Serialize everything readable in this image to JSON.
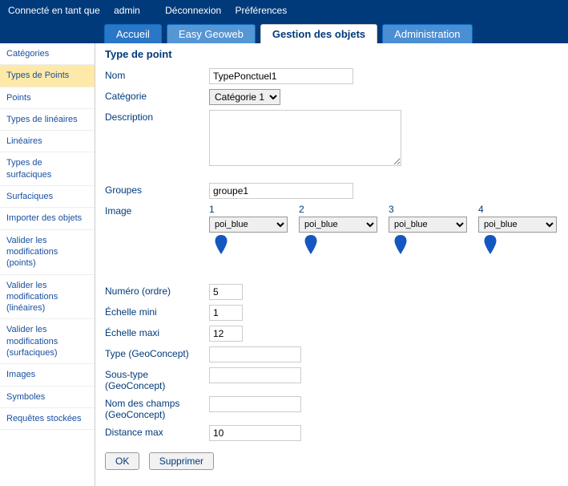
{
  "topbar": {
    "user_prefix": "Connecté en tant que ",
    "user": "admin",
    "logout": "Déconnexion",
    "prefs": "Préférences"
  },
  "tabs": {
    "home": "Accueil",
    "geoweb": "Easy Geoweb",
    "objects": "Gestion des objets",
    "admin": "Administration"
  },
  "sidebar": {
    "items": [
      "Catégories",
      "Types de Points",
      "Points",
      "Types de linéaires",
      "Linéaires",
      "Types de surfaciques",
      "Surfaciques",
      "Importer des objets",
      "Valider les modifications (points)",
      "Valider les modifications (linéaires)",
      "Valider les modifications (surfaciques)",
      "Images",
      "Symboles",
      "Requêtes stockées"
    ],
    "active_index": 1
  },
  "page": {
    "title": "Type de point"
  },
  "form": {
    "labels": {
      "nom": "Nom",
      "categorie": "Catégorie",
      "description": "Description",
      "groupes": "Groupes",
      "image": "Image",
      "numero": "Numéro (ordre)",
      "echelle_mini": "Échelle mini",
      "echelle_maxi": "Échelle maxi",
      "type_gc": "Type (GeoConcept)",
      "sous_type_gc": "Sous-type (GeoConcept)",
      "champs_gc": "Nom des champs (GeoConcept)",
      "distance_max": "Distance max"
    },
    "values": {
      "nom": "TypePonctuel1",
      "categorie": "Catégorie 1",
      "description": "",
      "groupes": "groupe1",
      "numero": "5",
      "echelle_mini": "1",
      "echelle_maxi": "12",
      "type_gc": "",
      "sous_type_gc": "",
      "champs_gc": "",
      "distance_max": "10"
    },
    "images": [
      {
        "n": "1",
        "sel": "poi_blue"
      },
      {
        "n": "2",
        "sel": "poi_blue"
      },
      {
        "n": "3",
        "sel": "poi_blue"
      },
      {
        "n": "4",
        "sel": "poi_blue"
      }
    ],
    "buttons": {
      "ok": "OK",
      "delete": "Supprimer"
    }
  }
}
